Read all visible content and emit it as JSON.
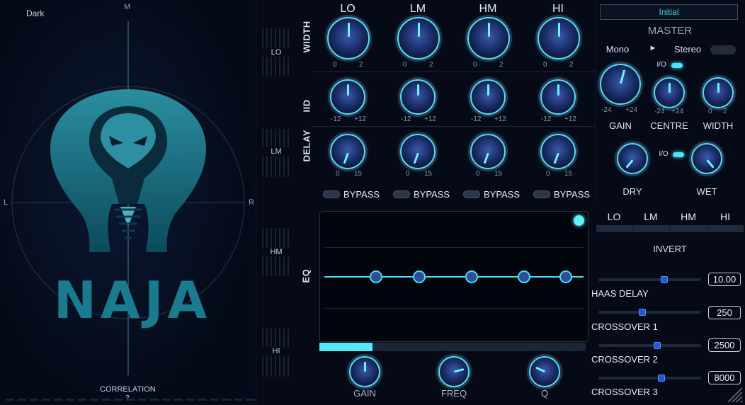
{
  "scope": {
    "theme_label": "Dark",
    "top_label": "M",
    "left_label": "L",
    "right_label": "R",
    "logo_text": "NAJA",
    "correlation_label": "CORRELATION",
    "correlation_value": "?"
  },
  "band_meters": [
    "LO",
    "LM",
    "HM",
    "HI"
  ],
  "grid": {
    "columns": [
      "LO",
      "LM",
      "HM",
      "HI"
    ],
    "rows": [
      {
        "label": "WIDTH",
        "min": "0",
        "max": "2"
      },
      {
        "label": "IID",
        "min": "-12",
        "max": "+12"
      },
      {
        "label": "DELAY",
        "min": "0",
        "max": "15"
      }
    ],
    "bypass_label": "BYPASS"
  },
  "eq": {
    "label": "EQ",
    "knobs": [
      "GAIN",
      "FREQ",
      "Q"
    ]
  },
  "master": {
    "preset": "Initial",
    "title": "MASTER",
    "mono_label": "Mono",
    "arrow": "►",
    "stereo_label": "Stereo",
    "io_label": "I/O",
    "gain": {
      "label": "GAIN",
      "min": "-24",
      "max": "+24"
    },
    "centre": {
      "label": "CENTRE",
      "min": "-24",
      "max": "+24"
    },
    "width": {
      "label": "WIDTH",
      "min": "0",
      "max": "2"
    },
    "dry_label": "DRY",
    "wet_label": "WET"
  },
  "invert": {
    "bands": [
      "LO",
      "LM",
      "HM",
      "HI"
    ],
    "label": "INVERT"
  },
  "params": [
    {
      "label": "HAAS DELAY",
      "value": "10.00",
      "level": 0.65
    },
    {
      "label": "CROSSOVER 1",
      "value": "250",
      "level": 0.42
    },
    {
      "label": "CROSSOVER 2",
      "value": "2500",
      "level": 0.58
    },
    {
      "label": "CROSSOVER 3",
      "value": "8000",
      "level": 0.62
    }
  ],
  "colors": {
    "accent": "#4de3f5",
    "background": "#050a16",
    "knob": "#1c2f6c"
  }
}
